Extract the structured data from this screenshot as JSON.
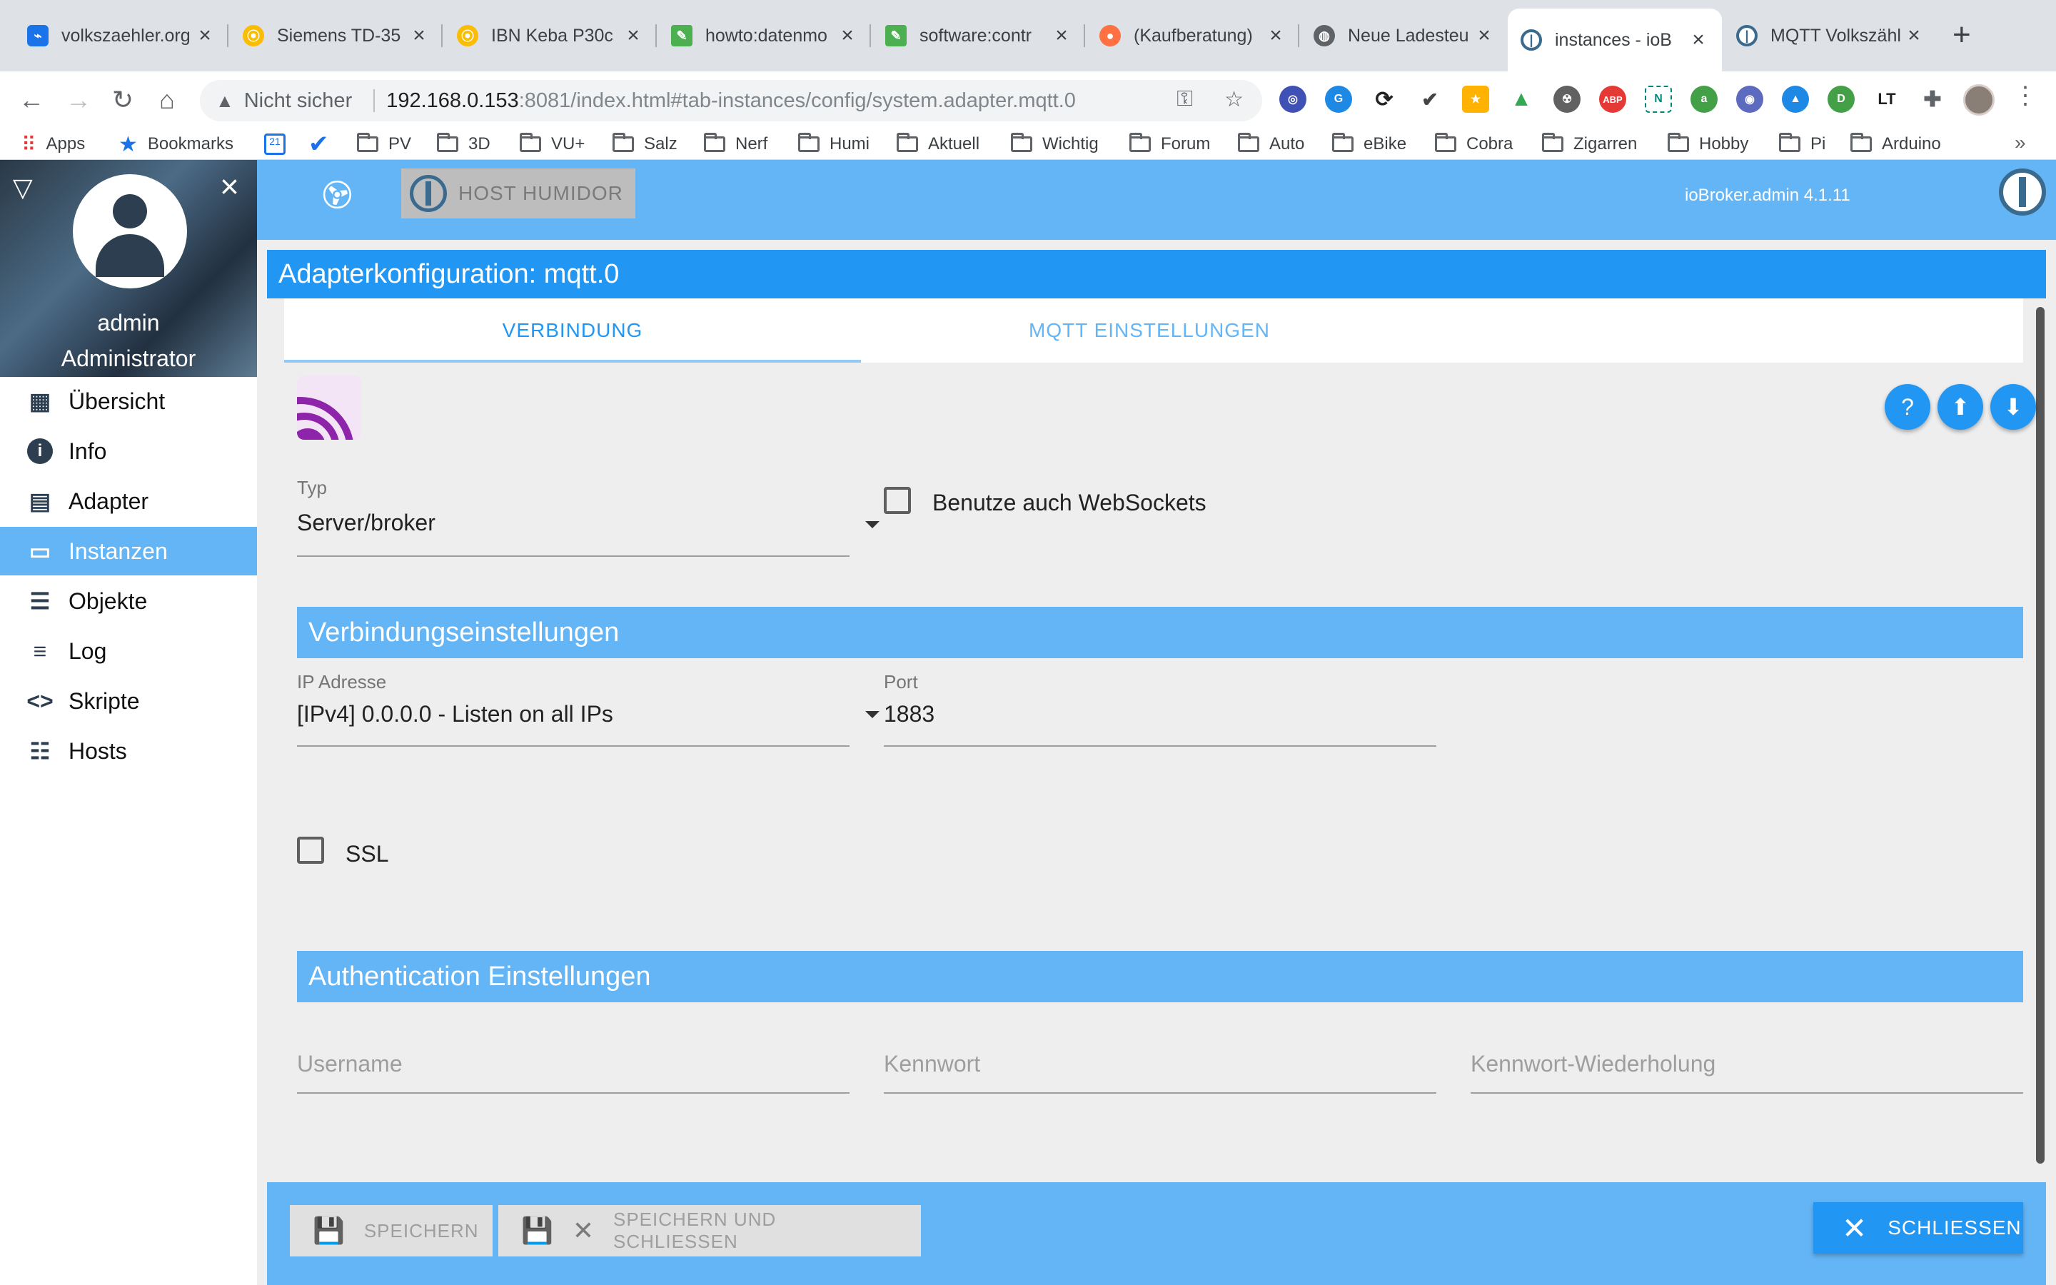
{
  "browser": {
    "tabs": [
      {
        "title": "volkszaehler.org",
        "icon": "volkszaehler-icon",
        "color": "#1a73e8"
      },
      {
        "title": "Siemens TD-35",
        "icon": "google-maps-icon",
        "color": "#fbbc04"
      },
      {
        "title": "IBN Keba P30c",
        "icon": "google-maps-icon",
        "color": "#fbbc04"
      },
      {
        "title": "howto:datenmo",
        "icon": "wiki-icon",
        "color": "#4caf50"
      },
      {
        "title": "software:contr",
        "icon": "wiki-icon",
        "color": "#4caf50"
      },
      {
        "title": "(Kaufberatung)",
        "icon": "forum-icon",
        "color": "#ff7043"
      },
      {
        "title": "Neue Ladesteu",
        "icon": "globe-icon",
        "color": "#5f6368"
      },
      {
        "title": "instances - ioB",
        "icon": "iobroker-icon",
        "color": "#3b6a8f"
      },
      {
        "title": "MQTT Volkszähl",
        "icon": "iobroker-icon",
        "color": "#3b6a8f"
      }
    ],
    "active_tab": 7,
    "address": {
      "security_label": "Nicht sicher",
      "host": "192.168.0.153",
      "path": ":8081/index.html#tab-instances/config/system.adapter.mqtt.0"
    },
    "bookmarks": [
      "Apps",
      "Bookmarks",
      "PV",
      "3D",
      "VU+",
      "Salz",
      "Nerf",
      "Humi",
      "Aktuell",
      "Wichtig",
      "Forum",
      "Auto",
      "eBike",
      "Cobra",
      "Zigarren",
      "Hobby",
      "Pi",
      "Arduino"
    ]
  },
  "sidebar": {
    "user_name": "admin",
    "user_role": "Administrator",
    "items": [
      {
        "label": "Übersicht",
        "icon": "grid-icon"
      },
      {
        "label": "Info",
        "icon": "info-icon"
      },
      {
        "label": "Adapter",
        "icon": "store-icon"
      },
      {
        "label": "Instanzen",
        "icon": "instances-icon"
      },
      {
        "label": "Objekte",
        "icon": "list-icon"
      },
      {
        "label": "Log",
        "icon": "log-icon"
      },
      {
        "label": "Skripte",
        "icon": "code-icon"
      },
      {
        "label": "Hosts",
        "icon": "hosts-icon"
      }
    ],
    "active_item": "Instanzen"
  },
  "header": {
    "host_label": "HOST HUMIDOR",
    "version": "ioBroker.admin 4.1.11",
    "accent": "#64b5f6"
  },
  "dialog": {
    "title": "Adapterkonfiguration: mqtt.0",
    "tabs": [
      "VERBINDUNG",
      "MQTT EINSTELLUNGEN"
    ],
    "active_tab": "VERBINDUNG",
    "type": {
      "label": "Typ",
      "value": "Server/broker"
    },
    "websockets": {
      "label": "Benutze auch WebSockets",
      "checked": false
    },
    "connection_section": "Verbindungseinstellungen",
    "ip": {
      "label": "IP Adresse",
      "value": "[IPv4] 0.0.0.0 - Listen on all IPs"
    },
    "port": {
      "label": "Port",
      "value": "1883"
    },
    "ssl": {
      "label": "SSL",
      "checked": false
    },
    "auth_section": "Authentication Einstellungen",
    "username": {
      "placeholder": "Username",
      "value": ""
    },
    "password": {
      "placeholder": "Kennwort",
      "value": ""
    },
    "password_repeat": {
      "placeholder": "Kennwort-Wiederholung",
      "value": ""
    }
  },
  "footer": {
    "save_label": "SPEICHERN",
    "save_close_label": "SPEICHERN UND SCHLIESSEN",
    "close_label": "SCHLIESSEN"
  }
}
